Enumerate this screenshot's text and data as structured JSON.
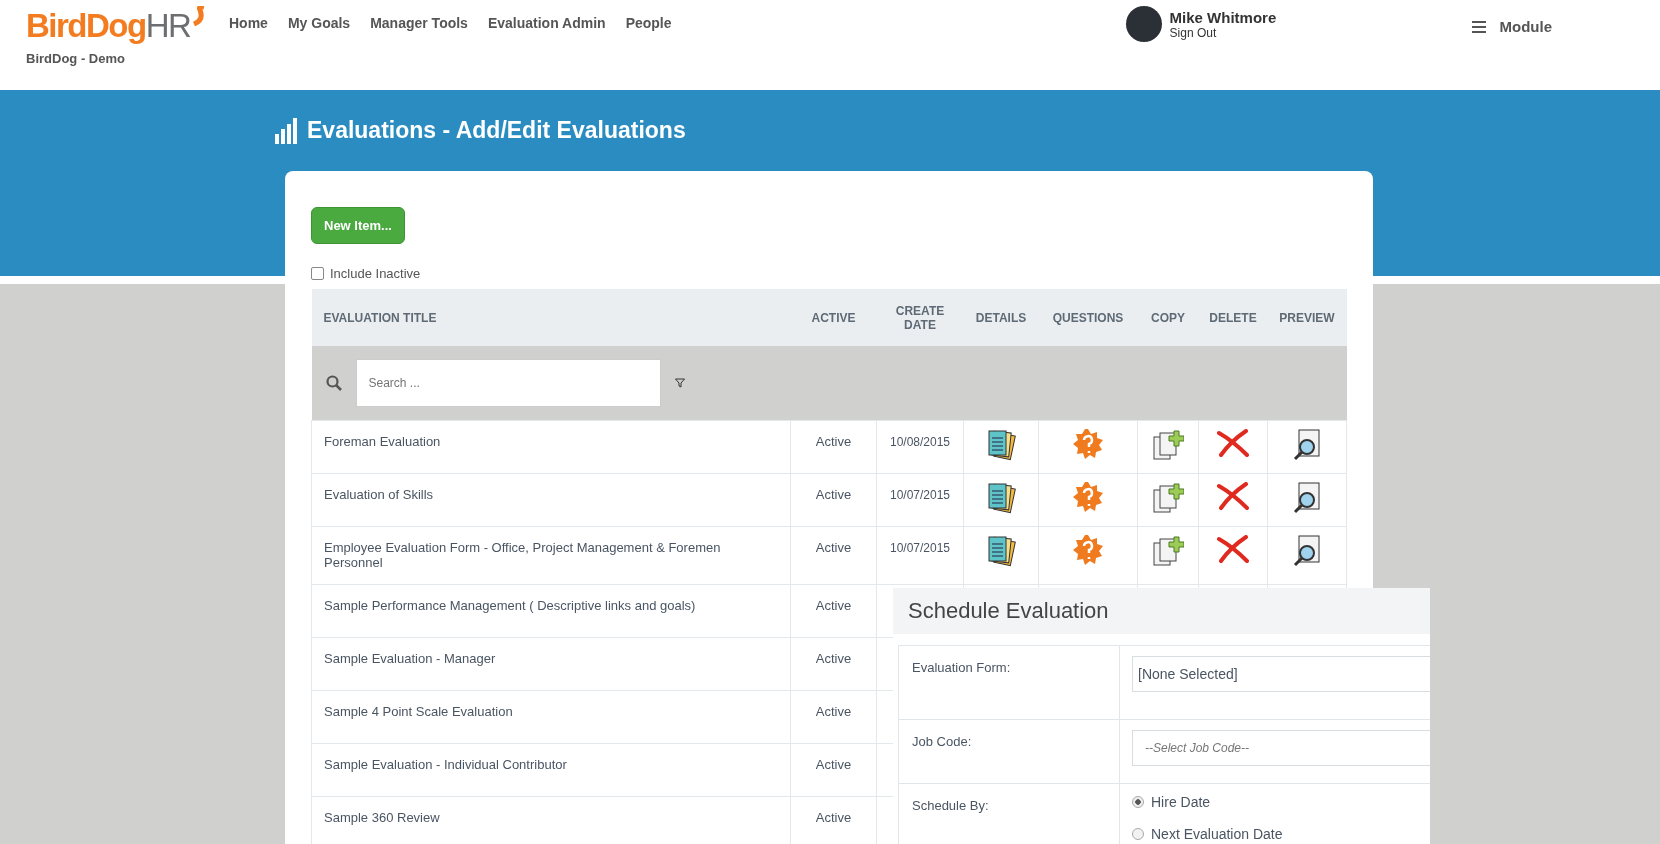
{
  "header": {
    "logo": {
      "primary": "BirdDog",
      "secondary": "HR"
    },
    "site": "BirdDog - Demo",
    "nav": [
      {
        "label": "Home"
      },
      {
        "label": "My Goals"
      },
      {
        "label": "Manager Tools"
      },
      {
        "label": "Evaluation Admin"
      },
      {
        "label": "People"
      }
    ],
    "user": {
      "name": "Mike Whitmore",
      "link": "Sign Out"
    },
    "menu": {
      "label": "Module"
    }
  },
  "page": {
    "title": "Evaluations - Add/Edit Evaluations"
  },
  "toolbar": {
    "new_button": "New Item...",
    "include_inactive": {
      "label": "Include Inactive",
      "checked": false
    }
  },
  "table": {
    "columns": [
      {
        "label": "EVALUATION TITLE"
      },
      {
        "label": "ACTIVE"
      },
      {
        "label": "CREATE DATE"
      },
      {
        "label": "DETAILS"
      },
      {
        "label": "QUESTIONS"
      },
      {
        "label": "COPY"
      },
      {
        "label": "DELETE"
      },
      {
        "label": "PREVIEW"
      }
    ],
    "search": {
      "placeholder": "Search ..."
    },
    "rows": [
      {
        "title": "Foreman Evaluation",
        "active": "Active",
        "create_date": "10/08/2015"
      },
      {
        "title": "Evaluation of Skills",
        "active": "Active",
        "create_date": "10/07/2015"
      },
      {
        "title": "Employee Evaluation Form - Office, Project Management & Foremen Personnel",
        "active": "Active",
        "create_date": "10/07/2015"
      },
      {
        "title": "Sample Performance Management ( Descriptive links and goals)",
        "active": "Active"
      },
      {
        "title": "Sample Evaluation - Manager",
        "active": "Active"
      },
      {
        "title": "Sample 4 Point Scale Evaluation",
        "active": "Active"
      },
      {
        "title": "Sample Evaluation - Individual Contributor",
        "active": "Active"
      },
      {
        "title": "Sample 360 Review",
        "active": "Active"
      }
    ]
  },
  "dialog": {
    "title": "Schedule Evaluation",
    "fields": [
      {
        "kind": "select",
        "label": "Evaluation Form:",
        "value": "[None Selected]"
      },
      {
        "kind": "select",
        "label": "Job Code:",
        "placeholder": "--Select Job Code--"
      },
      {
        "kind": "radio",
        "label": "Schedule By:",
        "options": [
          {
            "label": "Hire Date",
            "selected": true
          },
          {
            "label": "Next Evaluation Date",
            "selected": false
          }
        ]
      }
    ]
  }
}
